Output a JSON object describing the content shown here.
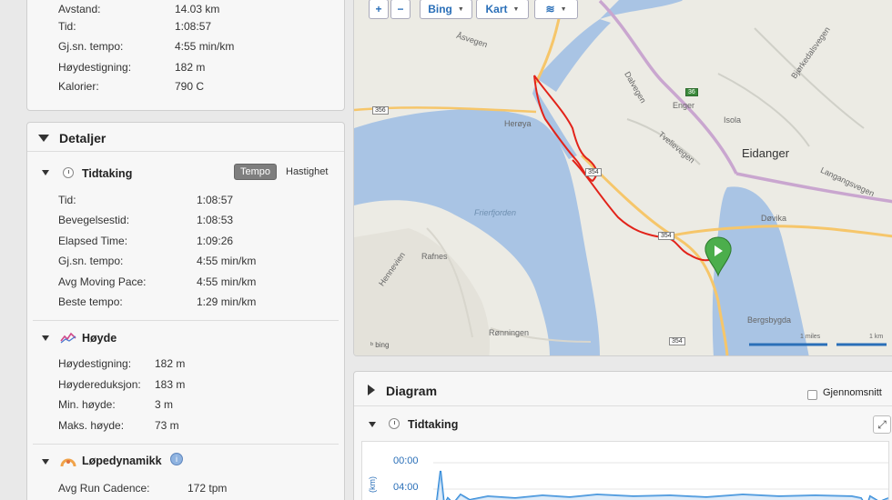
{
  "summary": {
    "rows": [
      {
        "label": "Avstand:",
        "value": "14.03 km"
      },
      {
        "label": "Tid:",
        "value": "1:08:57"
      },
      {
        "label": "Gj.sn. tempo:",
        "value": "4:55 min/km"
      },
      {
        "label": "Høydestigning:",
        "value": "182 m"
      },
      {
        "label": "Kalorier:",
        "value": "790 C"
      }
    ]
  },
  "details": {
    "title": "Detaljer",
    "timing": {
      "title": "Tidtaking",
      "toggle_active": "Tempo",
      "toggle_inactive": "Hastighet",
      "rows": [
        {
          "label": "Tid:",
          "value": "1:08:57"
        },
        {
          "label": "Bevegelsestid:",
          "value": "1:08:53"
        },
        {
          "label": "Elapsed Time:",
          "value": "1:09:26"
        },
        {
          "label": "Gj.sn. tempo:",
          "value": "4:55 min/km"
        },
        {
          "label": "Avg Moving Pace:",
          "value": "4:55 min/km"
        },
        {
          "label": "Beste tempo:",
          "value": "1:29 min/km"
        }
      ]
    },
    "elevation": {
      "title": "Høyde",
      "rows": [
        {
          "label": "Høydestigning:",
          "value": "182 m"
        },
        {
          "label": "Høydereduksjon:",
          "value": "183 m"
        },
        {
          "label": "Min. høyde:",
          "value": "3 m"
        },
        {
          "label": "Maks. høyde:",
          "value": "73 m"
        }
      ]
    },
    "dynamics": {
      "title": "Løpedynamikk",
      "rows": [
        {
          "label": "Avg Run Cadence:",
          "value": "172 tpm"
        }
      ]
    }
  },
  "map": {
    "zoom_in": "+",
    "zoom_out": "−",
    "provider": "Bing",
    "map_type": "Kart",
    "attribution": "bing",
    "scale_miles": "1 miles",
    "scale_km": "1 km",
    "places": {
      "eidanger": "Eidanger",
      "dovika": "Døvika",
      "bergsbygda": "Bergsbygda",
      "heroya": "Herøya",
      "frierfjorden": "Frierfjorden",
      "rafnes": "Rafnes",
      "ronningen": "Rønningen",
      "enger": "Enger",
      "isola": "Isola",
      "hennevien": "Hennevien",
      "dalvegen": "Dalvegen",
      "trollvegen": "Tvelievegen",
      "langangsvegen": "Langangsvegen",
      "bjorkedalsvegen": "Bjørkedalsvegen",
      "aaveien": "Åsvegen"
    },
    "roads": {
      "r356a": "356",
      "r356b": "356",
      "r354a": "354",
      "r354b": "354",
      "r354c": "354",
      "r36": "36"
    },
    "colors": {
      "water": "#a9c4e4",
      "land": "#ecebe4",
      "track": "#e2231a",
      "major_road": "#f6c66a",
      "motorway": "#c9a6cf"
    }
  },
  "diagram": {
    "title": "Diagram",
    "average_label": "Gjennomsnitt",
    "section_title": "Tidtaking",
    "y_axis_label": "(km)",
    "expand_icon": "⤢",
    "y_ticks": [
      "00:00",
      "04:00"
    ]
  }
}
